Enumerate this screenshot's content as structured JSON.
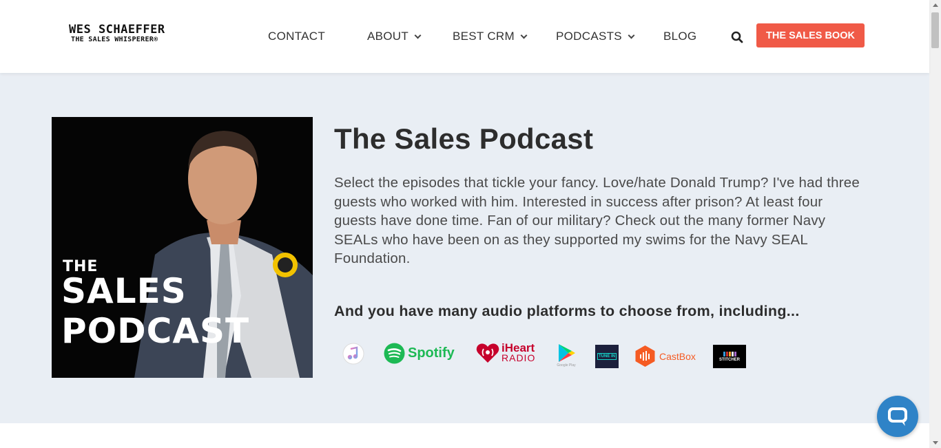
{
  "logo": {
    "name": "WES SCHAEFFER",
    "tagline": "THE SALES WHISPERER®"
  },
  "nav": {
    "items": [
      {
        "label": "CONTACT"
      },
      {
        "label": "ABOUT"
      },
      {
        "label": "BEST CRM"
      },
      {
        "label": "PODCASTS"
      },
      {
        "label": "BLOG"
      }
    ],
    "search_icon": "search-icon",
    "cta_label": "THE SALES BOOK"
  },
  "hero": {
    "cover": {
      "line1": "THE",
      "line2": "SALES",
      "line3": "PODCAST"
    },
    "title": "The Sales Podcast",
    "description": "Select the episodes that tickle your fancy. Love/hate Donald Trump? I've had three guests who worked with him. Interested in success after prison? At least four guests have done time. Fan of our military? Check out the many former Navy SEALs who have been on as they supported my swims for the Navy SEAL Foundation.",
    "platforms_heading": "And you have many audio platforms to choose from, including...",
    "platforms": [
      {
        "name": "apple-podcasts",
        "label": ""
      },
      {
        "name": "spotify",
        "label": "Spotify"
      },
      {
        "name": "iheartradio",
        "label": "iHeart",
        "sub": "RADIO"
      },
      {
        "name": "google-play",
        "label": "Google Play"
      },
      {
        "name": "tunein",
        "label": "TUNE IN"
      },
      {
        "name": "castbox",
        "label": "CastBox"
      },
      {
        "name": "stitcher",
        "label": "STITCHER"
      }
    ]
  },
  "colors": {
    "accent": "#f05a47",
    "hero_bg": "#e9eef4",
    "spotify": "#1db954",
    "iheart": "#c6002b",
    "castbox": "#f55b23",
    "chat": "#2f83c7"
  }
}
